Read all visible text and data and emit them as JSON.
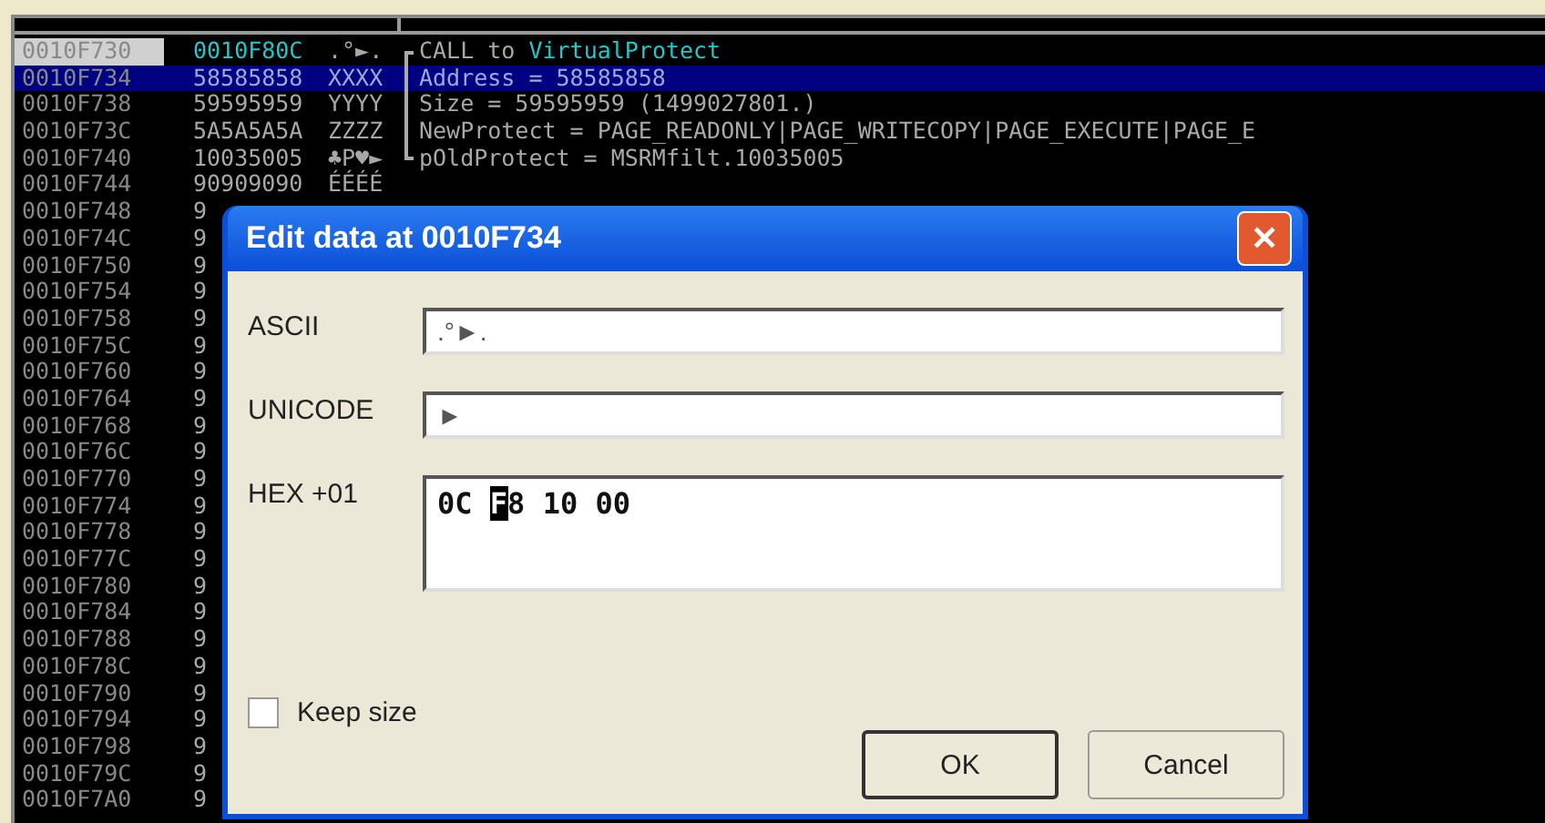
{
  "stack": {
    "rows": [
      {
        "address": "0010F730",
        "value": "0010F80C",
        "ascii": ".°►.",
        "highlight": true,
        "selected": false,
        "comment": {
          "kind": "start",
          "text": "CALL to",
          "target": "VirtualProtect"
        }
      },
      {
        "address": "0010F734",
        "value": "58585858",
        "ascii": "XXXX",
        "highlight": false,
        "selected": true,
        "comment": {
          "kind": "mid",
          "text": "Address = 58585858"
        }
      },
      {
        "address": "0010F738",
        "value": "59595959",
        "ascii": "YYYY",
        "highlight": false,
        "selected": false,
        "comment": {
          "kind": "mid",
          "text": "Size = 59595959 (1499027801.)"
        }
      },
      {
        "address": "0010F73C",
        "value": "5A5A5A5A",
        "ascii": "ZZZZ",
        "highlight": false,
        "selected": false,
        "comment": {
          "kind": "mid",
          "text": "NewProtect = PAGE_READONLY|PAGE_WRITECOPY|PAGE_EXECUTE|PAGE_E"
        }
      },
      {
        "address": "0010F740",
        "value": "10035005",
        "ascii": "♣P♥►",
        "highlight": false,
        "selected": false,
        "comment": {
          "kind": "end",
          "text": "pOldProtect = MSRMfilt.10035005"
        }
      },
      {
        "address": "0010F744",
        "value": "90909090",
        "ascii": "ÉÉÉÉ",
        "highlight": false,
        "selected": false
      },
      {
        "address": "0010F748",
        "value": "9",
        "highlight": false,
        "selected": false
      },
      {
        "address": "0010F74C",
        "value": "9",
        "highlight": false,
        "selected": false
      },
      {
        "address": "0010F750",
        "value": "9",
        "highlight": false,
        "selected": false
      },
      {
        "address": "0010F754",
        "value": "9",
        "highlight": false,
        "selected": false
      },
      {
        "address": "0010F758",
        "value": "9",
        "highlight": false,
        "selected": false
      },
      {
        "address": "0010F75C",
        "value": "9",
        "highlight": false,
        "selected": false
      },
      {
        "address": "0010F760",
        "value": "9",
        "highlight": false,
        "selected": false
      },
      {
        "address": "0010F764",
        "value": "9",
        "highlight": false,
        "selected": false
      },
      {
        "address": "0010F768",
        "value": "9",
        "highlight": false,
        "selected": false
      },
      {
        "address": "0010F76C",
        "value": "9",
        "highlight": false,
        "selected": false
      },
      {
        "address": "0010F770",
        "value": "9",
        "highlight": false,
        "selected": false
      },
      {
        "address": "0010F774",
        "value": "9",
        "highlight": false,
        "selected": false
      },
      {
        "address": "0010F778",
        "value": "9",
        "highlight": false,
        "selected": false
      },
      {
        "address": "0010F77C",
        "value": "9",
        "highlight": false,
        "selected": false
      },
      {
        "address": "0010F780",
        "value": "9",
        "highlight": false,
        "selected": false
      },
      {
        "address": "0010F784",
        "value": "9",
        "highlight": false,
        "selected": false
      },
      {
        "address": "0010F788",
        "value": "9",
        "highlight": false,
        "selected": false
      },
      {
        "address": "0010F78C",
        "value": "9",
        "highlight": false,
        "selected": false
      },
      {
        "address": "0010F790",
        "value": "9",
        "highlight": false,
        "selected": false
      },
      {
        "address": "0010F794",
        "value": "9",
        "highlight": false,
        "selected": false
      },
      {
        "address": "0010F798",
        "value": "9",
        "highlight": false,
        "selected": false
      },
      {
        "address": "0010F79C",
        "value": "9",
        "highlight": false,
        "selected": false
      },
      {
        "address": "0010F7A0",
        "value": "9",
        "highlight": false,
        "selected": false
      }
    ]
  },
  "dialog": {
    "title": "Edit data at 0010F734",
    "close": "✕",
    "fields": [
      {
        "label": "ASCII",
        "kind": "line",
        "value": ".°►."
      },
      {
        "label": "UNICODE",
        "kind": "line",
        "value": "►"
      },
      {
        "label": "HEX +01",
        "kind": "hex",
        "before": "0C ",
        "cursor": "F",
        "after": "8 10 00"
      }
    ],
    "keep_size": {
      "label": "Keep size",
      "checked": false
    },
    "buttons": [
      {
        "label": "OK",
        "default": true
      },
      {
        "label": "Cancel",
        "default": false
      }
    ]
  }
}
